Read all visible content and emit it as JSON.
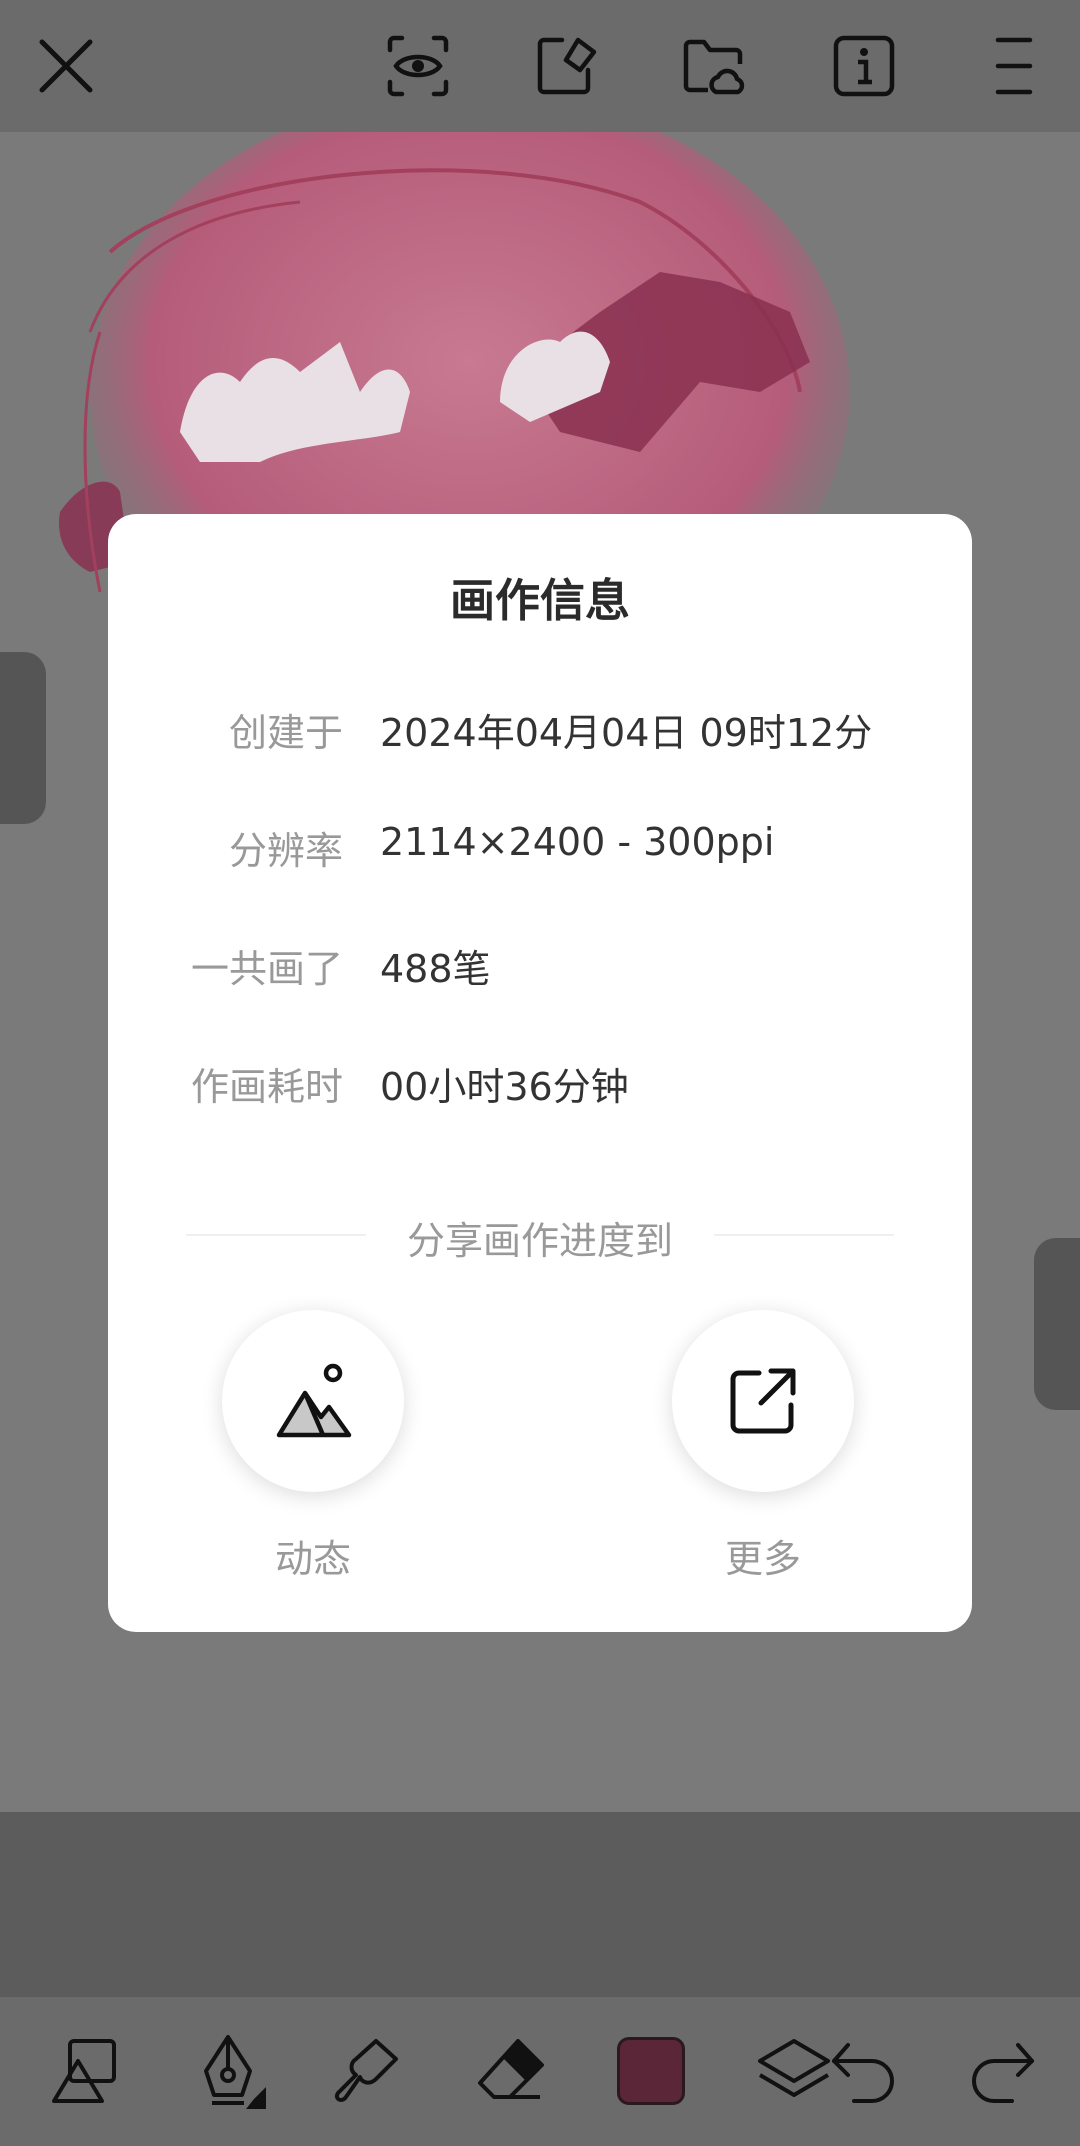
{
  "topbar": {
    "icons": [
      "close-icon",
      "eye-scan-icon",
      "sticker-icon",
      "cloud-folder-icon",
      "info-icon",
      "menu-icon"
    ]
  },
  "dialog": {
    "title": "画作信息",
    "rows": [
      {
        "label": "创建于",
        "value": "2024年04月04日 09时12分"
      },
      {
        "label": "分辨率",
        "value": "2114×2400 - 300ppi"
      },
      {
        "label": "一共画了",
        "value": "488笔"
      },
      {
        "label": "作画耗时",
        "value": "00小时36分钟"
      }
    ],
    "share_title": "分享画作进度到",
    "share_buttons": [
      {
        "label": "动态",
        "icon": "image-mountain-icon"
      },
      {
        "label": "更多",
        "icon": "external-link-icon"
      }
    ]
  },
  "toolbar": {
    "tools": [
      "shapes-icon",
      "pen-nib-icon",
      "smudge-icon",
      "eraser-icon",
      "color-swatch",
      "layers-icon",
      "undo-icon",
      "redo-icon"
    ],
    "current_color": "#5a2638"
  },
  "colors": {
    "overlay": "#7a7a7a",
    "dialog_bg": "#ffffff",
    "artwork_pink": "#c4607f"
  }
}
